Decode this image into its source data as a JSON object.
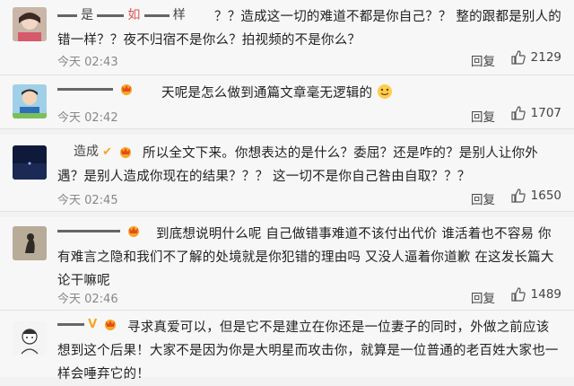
{
  "comments": [
    {
      "name_prefix": "是",
      "name_middle": "如",
      "name_suffix": "样",
      "text": "？？造成这一切的难道不都是你自己？？ 整的跟都是别人的错一样？？夜不归宿不是你么？拍视频的不是你么？",
      "time": "今天 02:43",
      "reply_label": "回复",
      "likes": "2129"
    },
    {
      "name_prefix": "",
      "text": "天呢是怎么做到通篇文章毫无逻辑的",
      "time": "今天 02:42",
      "reply_label": "回复",
      "likes": "1707"
    },
    {
      "name_prefix": "造成",
      "text": "所以全文下来。你想表达的是什么？委屈？还是咋的？是别人让你外遇？是别人造成你现在的结果？？？ 这一切不是你自己咎由自取？？？",
      "time": "今天 02:45",
      "reply_label": "回复",
      "likes": "1650"
    },
    {
      "name_prefix": "",
      "text": "到底想说明什么呢 自己做错事难道不该付出代价 谁活着也不容易 你有难言之隐和我们不了解的处境就是你犯错的理由吗 又没人逼着你道歉 在这发长篇大论干嘛呢",
      "time": "今天 02:46",
      "reply_label": "回复",
      "likes": "1489"
    },
    {
      "name_prefix": "",
      "text": "寻求真爱可以，但是它不是建立在你还是一位妻子的同时，外做之前应该想到这个后果！大家不是因为你是大明星而攻击你，就算是一位普通的老百姓大家也一样会唾弃它的！",
      "time": "",
      "reply_label": "",
      "likes": ""
    }
  ],
  "colors": {
    "badge_orange": "#f5a623",
    "badge_red": "#e64a19",
    "like_icon": "#555555"
  }
}
